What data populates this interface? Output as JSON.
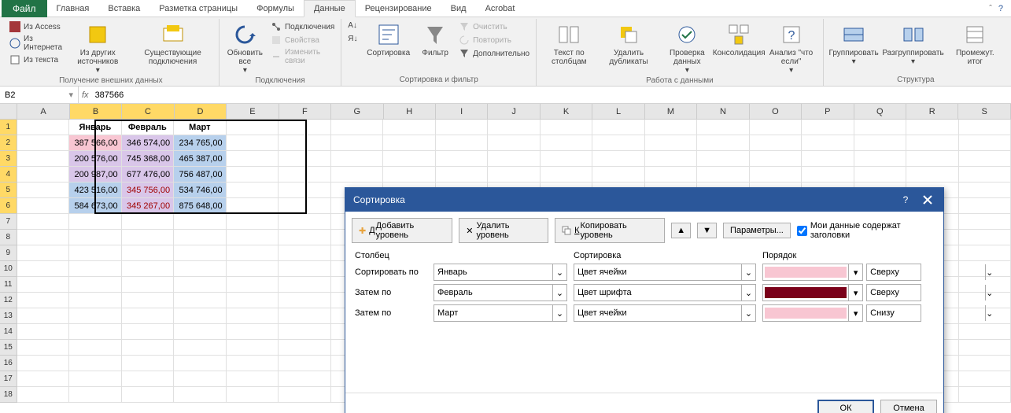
{
  "tabs": {
    "file": "Файл",
    "items": [
      "Главная",
      "Вставка",
      "Разметка страницы",
      "Формулы",
      "Данные",
      "Рецензирование",
      "Вид",
      "Acrobat"
    ],
    "active_index": 4
  },
  "ribbon": {
    "ext_data": {
      "access": "Из Access",
      "web": "Из Интернета",
      "text": "Из текста",
      "other": "Из других источников",
      "existing": "Существующие подключения",
      "label": "Получение внешних данных"
    },
    "connections": {
      "refresh": "Обновить все",
      "conn": "Подключения",
      "props": "Свойства",
      "edit_links": "Изменить связи",
      "label": "Подключения"
    },
    "sortfilter": {
      "az": "А↓Я",
      "za": "Я↓А",
      "sort": "Сортировка",
      "filter": "Фильтр",
      "clear": "Очистить",
      "reapply": "Повторить",
      "advanced": "Дополнительно",
      "label": "Сортировка и фильтр"
    },
    "datatools": {
      "t2c": "Текст по столбцам",
      "dup": "Удалить дубликаты",
      "valid": "Проверка данных",
      "consol": "Консолидация",
      "whatif": "Анализ \"что если\"",
      "label": "Работа с данными"
    },
    "outline": {
      "group": "Группировать",
      "ungroup": "Разгруппировать",
      "subtotal": "Промежут. итог",
      "label": "Структура"
    }
  },
  "formula_bar": {
    "name_box": "B2",
    "fx": "fx",
    "value": "387566"
  },
  "grid": {
    "cols": [
      "A",
      "B",
      "C",
      "D",
      "E",
      "F",
      "G",
      "H",
      "I",
      "J",
      "K",
      "L",
      "M",
      "N",
      "O",
      "P",
      "Q",
      "R",
      "S"
    ],
    "selected_cols": [
      1,
      2,
      3
    ],
    "rows": 26,
    "selected_rows": [
      1,
      2,
      3,
      4,
      5,
      6
    ],
    "headers": [
      "Январь",
      "Февраль",
      "Март"
    ],
    "data": [
      [
        {
          "v": "387 566,00",
          "bg": "#f8c6d2"
        },
        {
          "v": "346 574,00",
          "bg": "#d9c6e9"
        },
        {
          "v": "234 765,00",
          "bg": "#b7d0ec"
        }
      ],
      [
        {
          "v": "200 576,00",
          "bg": "#d9c6e9"
        },
        {
          "v": "745 368,00",
          "bg": "#d9c6e9"
        },
        {
          "v": "465 387,00",
          "bg": "#b7d0ec"
        }
      ],
      [
        {
          "v": "200 987,00",
          "bg": "#d9c6e9"
        },
        {
          "v": "677 476,00",
          "bg": "#d9c6e9"
        },
        {
          "v": "756 487,00",
          "bg": "#b7d0ec"
        }
      ],
      [
        {
          "v": "423 516,00",
          "bg": "#b7d0ec"
        },
        {
          "v": "345 756,00",
          "bg": "#d9c6e9",
          "fg": "#a00000"
        },
        {
          "v": "534 746,00",
          "bg": "#b7d0ec"
        }
      ],
      [
        {
          "v": "584 673,00",
          "bg": "#b7d0ec"
        },
        {
          "v": "345 267,00",
          "bg": "#d9c6e9",
          "fg": "#a00000"
        },
        {
          "v": "875 648,00",
          "bg": "#b7d0ec"
        }
      ]
    ]
  },
  "dialog": {
    "title": "Сортировка",
    "help_icon": "?",
    "add_level": "Добавить уровень",
    "del_level": "Удалить уровень",
    "copy_level": "Копировать уровень",
    "options": "Параметры...",
    "headers_check": "Мои данные содержат заголовки",
    "col_head": "Столбец",
    "sort_head": "Сортировка",
    "order_head": "Порядок",
    "sort_by": "Сортировать по",
    "then_by": "Затем по",
    "rows": [
      {
        "label": "Сортировать по",
        "field": "Январь",
        "sort": "Цвет ячейки",
        "color": "#f8c6d2",
        "pos": "Сверху"
      },
      {
        "label": "Затем по",
        "field": "Февраль",
        "sort": "Цвет шрифта",
        "color": "#7a0019",
        "pos": "Сверху"
      },
      {
        "label": "Затем по",
        "field": "Март",
        "sort": "Цвет ячейки",
        "color": "#f8c6d2",
        "pos": "Снизу"
      }
    ],
    "ok": "ОК",
    "cancel": "Отмена"
  }
}
